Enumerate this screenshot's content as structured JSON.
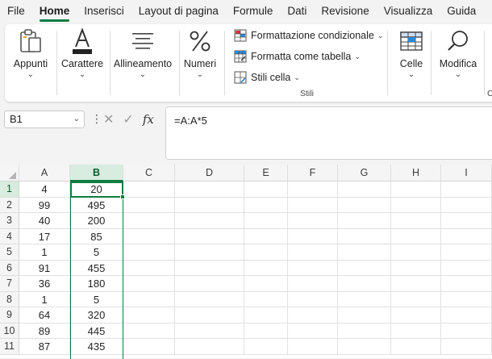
{
  "menu": {
    "items": [
      "File",
      "Home",
      "Inserisci",
      "Layout di pagina",
      "Formule",
      "Dati",
      "Revisione",
      "Visualizza",
      "Guida"
    ],
    "active_index": 1
  },
  "ribbon": {
    "appunti": "Appunti",
    "carattere": "Carattere",
    "allineamento": "Allineamento",
    "numeri": "Numeri",
    "formattazione_condizionale": "Formattazione condizionale",
    "formatta_come_tabella": "Formatta come tabella",
    "stili_cella": "Stili cella",
    "stili_caption": "Stili",
    "celle": "Celle",
    "modifica": "Modifica",
    "next_caption": "C",
    "colors": {
      "accent": "#107c41"
    }
  },
  "formula": {
    "name_box": "B1",
    "content": "=A:A*5",
    "fx_label": "fx"
  },
  "grid": {
    "columns": [
      "A",
      "B",
      "C",
      "D",
      "E",
      "F",
      "G",
      "H",
      "I"
    ],
    "selected_column": "B",
    "rows": [
      {
        "n": "1",
        "a": "4",
        "b": "20"
      },
      {
        "n": "2",
        "a": "99",
        "b": "495"
      },
      {
        "n": "3",
        "a": "40",
        "b": "200"
      },
      {
        "n": "4",
        "a": "17",
        "b": "85"
      },
      {
        "n": "5",
        "a": "1",
        "b": "5"
      },
      {
        "n": "6",
        "a": "91",
        "b": "455"
      },
      {
        "n": "7",
        "a": "36",
        "b": "180"
      },
      {
        "n": "8",
        "a": "1",
        "b": "5"
      },
      {
        "n": "9",
        "a": "64",
        "b": "320"
      },
      {
        "n": "10",
        "a": "89",
        "b": "445"
      },
      {
        "n": "11",
        "a": "87",
        "b": "435"
      }
    ]
  }
}
